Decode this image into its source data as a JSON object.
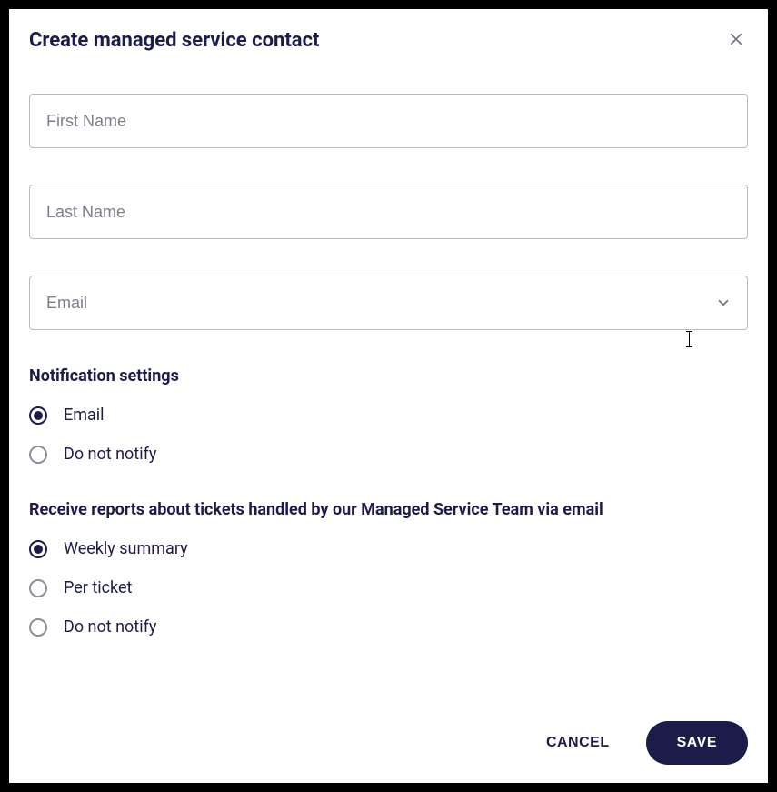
{
  "dialog": {
    "title": "Create managed service contact",
    "fields": {
      "first_name": {
        "placeholder": "First Name",
        "value": ""
      },
      "last_name": {
        "placeholder": "Last Name",
        "value": ""
      },
      "email": {
        "placeholder": "Email",
        "value": ""
      }
    },
    "notification": {
      "title": "Notification settings",
      "options": [
        {
          "label": "Email",
          "selected": true
        },
        {
          "label": "Do not notify",
          "selected": false
        }
      ]
    },
    "reports": {
      "title": "Receive reports about tickets handled by our Managed Service Team via email",
      "options": [
        {
          "label": "Weekly summary",
          "selected": true
        },
        {
          "label": "Per ticket",
          "selected": false
        },
        {
          "label": "Do not notify",
          "selected": false
        }
      ]
    },
    "actions": {
      "cancel": "CANCEL",
      "save": "SAVE"
    }
  }
}
